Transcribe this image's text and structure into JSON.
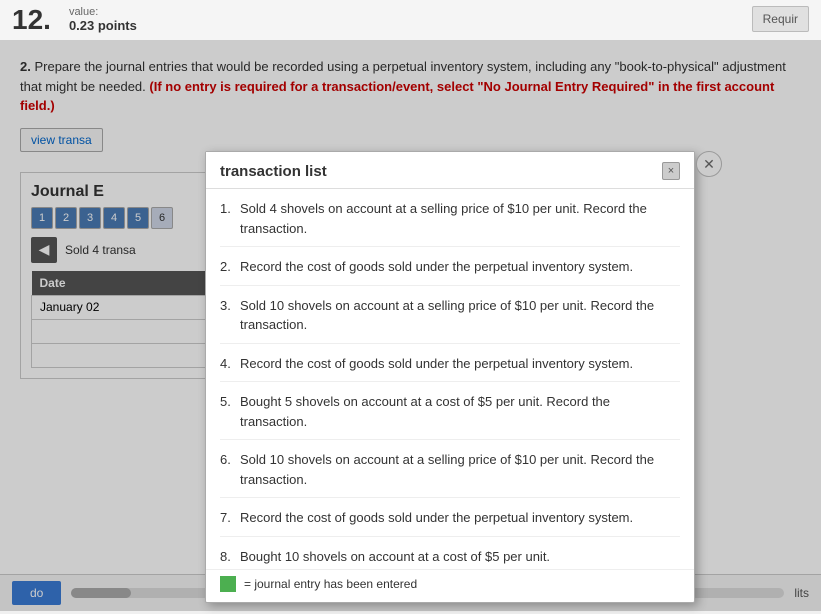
{
  "topBar": {
    "questionNumber": "12.",
    "valueLabel": "value:",
    "valuePoints": "0.23 points",
    "requireButton": "Requir"
  },
  "questionText": {
    "number": "2.",
    "main": "Prepare the journal entries that would be recorded using a perpetual inventory system, including any \"book-to-physical\" adjustment that might be needed.",
    "warning": "(If no entry is required for a transaction/event, select \"No Journal Entry Required\" in the first account field.)"
  },
  "viewTransButton": "view transa",
  "journal": {
    "title": "Journal E",
    "tabs": [
      "1",
      "2",
      "3",
      "4",
      "5",
      "6"
    ],
    "transactionText": "Sold 4 transa",
    "tableHeaders": [
      "Date",
      "",
      "",
      ""
    ],
    "dateValue": "January 02"
  },
  "modal": {
    "title": "transaction list",
    "items": [
      {
        "number": "1.",
        "text": "Sold 4 shovels on account at a selling price of $10 per unit. Record the transaction."
      },
      {
        "number": "2.",
        "text": "Record the cost of goods sold under the perpetual inventory system."
      },
      {
        "number": "3.",
        "text": "Sold 10 shovels on account at a selling price of $10 per unit. Record the transaction."
      },
      {
        "number": "4.",
        "text": "Record the cost of goods sold under the perpetual inventory system."
      },
      {
        "number": "5.",
        "text": "Bought 5 shovels on account at a cost of $5 per unit. Record the transaction."
      },
      {
        "number": "6.",
        "text": "Sold 10 shovels on account at a selling price of $10 per unit. Record the transaction."
      },
      {
        "number": "7.",
        "text": "Record the cost of goods sold under the perpetual inventory system."
      },
      {
        "number": "8.",
        "text": "Bought 10 shovels on account at a cost of $5 per unit."
      }
    ],
    "legendText": "= journal entry has been entered",
    "closeLabel": "×"
  },
  "bottomBar": {
    "doneButton": "do",
    "unitsLabel": "lits"
  }
}
